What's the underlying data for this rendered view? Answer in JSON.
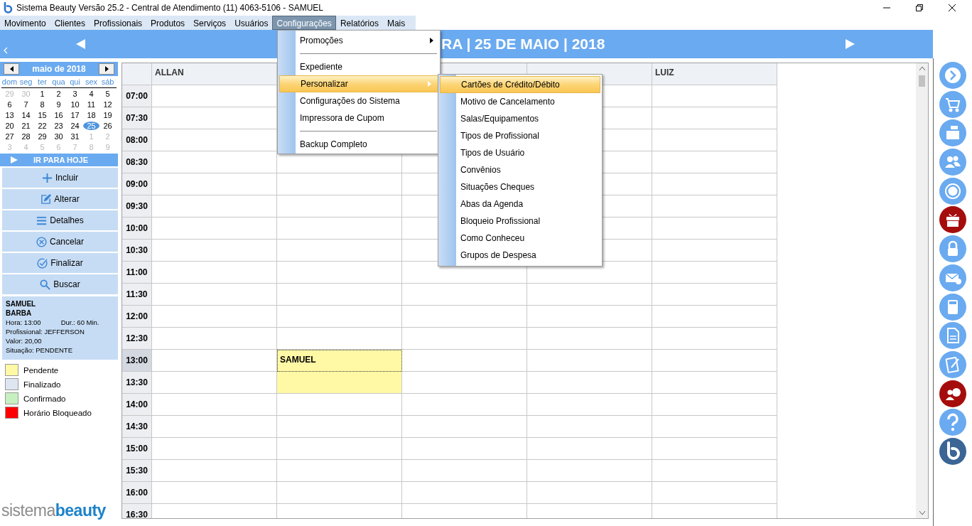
{
  "window": {
    "title": "Sistema Beauty Versão 25.2 - Central de Atendimento (11) 4063-5106 - SAMUEL"
  },
  "menu_bar": [
    {
      "label": "Movimento",
      "selected": false
    },
    {
      "label": "Clientes",
      "selected": false
    },
    {
      "label": "Profissionais",
      "selected": false
    },
    {
      "label": "Produtos",
      "selected": false
    },
    {
      "label": "Serviços",
      "selected": false
    },
    {
      "label": "Usuários",
      "selected": false
    },
    {
      "label": "Configurações",
      "selected": true
    },
    {
      "label": "Relatórios",
      "selected": false
    },
    {
      "label": "Mais",
      "selected": false
    }
  ],
  "menu": {
    "items": [
      {
        "kind": "item",
        "label": "Promoções",
        "submenu": true,
        "selected": false
      },
      {
        "kind": "separator"
      },
      {
        "kind": "item",
        "label": "Expediente",
        "selected": false
      },
      {
        "kind": "item",
        "label": "Personalizar",
        "submenu": true,
        "selected": true
      },
      {
        "kind": "item",
        "label": "Configurações do Sistema",
        "selected": false
      },
      {
        "kind": "item",
        "label": "Impressora de Cupom",
        "selected": false
      },
      {
        "kind": "separator"
      },
      {
        "kind": "item",
        "label": "Backup Completo",
        "selected": false
      }
    ]
  },
  "submenu": {
    "items": [
      {
        "label": "Cartões de Crédito/Débito",
        "selected": true
      },
      {
        "label": "Motivo de Cancelamento",
        "selected": false
      },
      {
        "label": "Salas/Equipamentos",
        "selected": false
      },
      {
        "label": "Tipos de Profissional",
        "selected": false
      },
      {
        "label": "Tipos de Usuário",
        "selected": false
      },
      {
        "label": "Convênios",
        "selected": false
      },
      {
        "label": "Situações Cheques",
        "selected": false
      },
      {
        "label": "Abas da Agenda",
        "selected": false
      },
      {
        "label": "Bloqueio Profissional",
        "selected": false
      },
      {
        "label": "Como Conheceu",
        "selected": false
      },
      {
        "label": "Grupos de Despesa",
        "selected": false
      }
    ]
  },
  "header": {
    "title": "RA | 25 DE MAIO | 2018"
  },
  "calendar": {
    "month": "maio de 2018",
    "weekdays": [
      "dom",
      "seg",
      "ter",
      "qua",
      "qui",
      "sex",
      "sáb"
    ],
    "days": [
      {
        "d": "29",
        "outside": true,
        "selected": false
      },
      {
        "d": "30",
        "outside": true,
        "selected": false
      },
      {
        "d": "1",
        "outside": false,
        "selected": false
      },
      {
        "d": "2",
        "outside": false,
        "selected": false
      },
      {
        "d": "3",
        "outside": false,
        "selected": false
      },
      {
        "d": "4",
        "outside": false,
        "selected": false
      },
      {
        "d": "5",
        "outside": false,
        "selected": false
      },
      {
        "d": "6",
        "outside": false,
        "selected": false
      },
      {
        "d": "7",
        "outside": false,
        "selected": false
      },
      {
        "d": "8",
        "outside": false,
        "selected": false
      },
      {
        "d": "9",
        "outside": false,
        "selected": false
      },
      {
        "d": "10",
        "outside": false,
        "selected": false
      },
      {
        "d": "11",
        "outside": false,
        "selected": false
      },
      {
        "d": "12",
        "outside": false,
        "selected": false
      },
      {
        "d": "13",
        "outside": false,
        "selected": false
      },
      {
        "d": "14",
        "outside": false,
        "selected": false
      },
      {
        "d": "15",
        "outside": false,
        "selected": false
      },
      {
        "d": "16",
        "outside": false,
        "selected": false
      },
      {
        "d": "17",
        "outside": false,
        "selected": false
      },
      {
        "d": "18",
        "outside": false,
        "selected": false
      },
      {
        "d": "19",
        "outside": false,
        "selected": false
      },
      {
        "d": "20",
        "outside": false,
        "selected": false
      },
      {
        "d": "21",
        "outside": false,
        "selected": false
      },
      {
        "d": "22",
        "outside": false,
        "selected": false
      },
      {
        "d": "23",
        "outside": false,
        "selected": false
      },
      {
        "d": "24",
        "outside": false,
        "selected": false
      },
      {
        "d": "25",
        "outside": false,
        "selected": true
      },
      {
        "d": "26",
        "outside": false,
        "selected": false
      },
      {
        "d": "27",
        "outside": false,
        "selected": false
      },
      {
        "d": "28",
        "outside": false,
        "selected": false
      },
      {
        "d": "29",
        "outside": false,
        "selected": false
      },
      {
        "d": "30",
        "outside": false,
        "selected": false
      },
      {
        "d": "31",
        "outside": false,
        "selected": false
      },
      {
        "d": "1",
        "outside": true,
        "selected": false
      },
      {
        "d": "2",
        "outside": true,
        "selected": false
      },
      {
        "d": "3",
        "outside": true,
        "selected": false
      },
      {
        "d": "4",
        "outside": true,
        "selected": false
      },
      {
        "d": "5",
        "outside": true,
        "selected": false
      },
      {
        "d": "6",
        "outside": true,
        "selected": false
      },
      {
        "d": "7",
        "outside": true,
        "selected": false
      },
      {
        "d": "8",
        "outside": true,
        "selected": false
      },
      {
        "d": "9",
        "outside": true,
        "selected": false
      }
    ]
  },
  "today_button": "IR PARA HOJE",
  "actions": [
    "Incluir",
    "Alterar",
    "Detalhes",
    "Cancelar",
    "Finalizar",
    "Buscar"
  ],
  "details": {
    "name": "SAMUEL",
    "service": "BARBA",
    "time": "Hora: 13:00",
    "duration": "Dur.: 60 Min.",
    "professional": "Profissional: JEFFERSON",
    "value": "Valor: 20,00",
    "status": "Situação: PENDENTE"
  },
  "legend": [
    {
      "label": "Pendente",
      "color": "#fff9a6"
    },
    {
      "label": "Finalizado",
      "color": "#dfe5f1"
    },
    {
      "label": "Confirmado",
      "color": "#c6f0c0"
    },
    {
      "label": "Horário Bloqueado",
      "color": "#ff0000"
    }
  ],
  "schedule": {
    "columns": [
      "ALLAN",
      null,
      null,
      null,
      "LUIZ"
    ],
    "rows": [
      {
        "time": "07:00",
        "selected": false
      },
      {
        "time": "07:30",
        "selected": false
      },
      {
        "time": "08:00",
        "selected": false
      },
      {
        "time": "08:30",
        "selected": false
      },
      {
        "time": "09:00",
        "selected": false
      },
      {
        "time": "09:30",
        "selected": false
      },
      {
        "time": "10:00",
        "selected": false
      },
      {
        "time": "10:30",
        "selected": false
      },
      {
        "time": "11:00",
        "selected": false
      },
      {
        "time": "11:30",
        "selected": false
      },
      {
        "time": "12:00",
        "selected": false
      },
      {
        "time": "12:30",
        "selected": false
      },
      {
        "time": "13:00",
        "selected": true,
        "cells": [
          null,
          {
            "text": "SAMUEL",
            "color": "#fff9a6",
            "focused": true
          },
          null,
          null,
          null
        ]
      },
      {
        "time": "13:30",
        "selected": false,
        "cells": [
          null,
          {
            "color": "#fff9a6",
            "focused": false
          },
          null,
          null,
          null
        ]
      },
      {
        "time": "14:00",
        "selected": false
      },
      {
        "time": "14:30",
        "selected": false
      },
      {
        "time": "15:00",
        "selected": false
      },
      {
        "time": "15:30",
        "selected": false
      },
      {
        "time": "16:00",
        "selected": false
      },
      {
        "time": "16:30",
        "selected": false
      }
    ]
  },
  "logo": {
    "part_1": "sistema",
    "part_2": "beauty"
  }
}
